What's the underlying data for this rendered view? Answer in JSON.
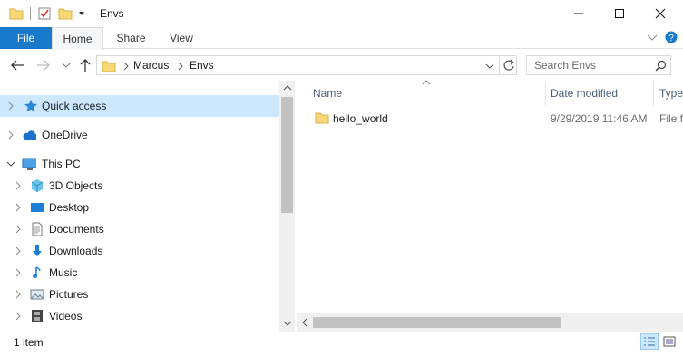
{
  "window": {
    "title": "Envs",
    "minimize_glyph": "—",
    "maximize_glyph": "☐",
    "close_glyph": "✕"
  },
  "ribbon": {
    "tabs": [
      "File",
      "Home",
      "Share",
      "View"
    ]
  },
  "address": {
    "crumbs": [
      "Marcus",
      "Envs"
    ],
    "search_placeholder": "Search Envs"
  },
  "nav": {
    "items": [
      {
        "label": "Quick access",
        "icon": "star-icon",
        "selected": true
      },
      {
        "label": "OneDrive",
        "icon": "cloud-icon"
      },
      {
        "label": "This PC",
        "icon": "pc-icon",
        "expanded": true
      },
      {
        "label": "3D Objects",
        "icon": "cube-icon"
      },
      {
        "label": "Desktop",
        "icon": "desktop-icon"
      },
      {
        "label": "Documents",
        "icon": "document-icon"
      },
      {
        "label": "Downloads",
        "icon": "download-icon"
      },
      {
        "label": "Music",
        "icon": "music-icon"
      },
      {
        "label": "Pictures",
        "icon": "pictures-icon"
      },
      {
        "label": "Videos",
        "icon": "video-icon"
      }
    ]
  },
  "columns": {
    "name": "Name",
    "date": "Date modified",
    "type": "Type"
  },
  "files": [
    {
      "name": "hello_world",
      "date": "9/29/2019 11:46 AM",
      "type": "File fo"
    }
  ],
  "status": {
    "count": "1 item"
  },
  "colors": {
    "accent": "#1979ca",
    "selection": "#cce8ff",
    "folder": "#f8d775"
  }
}
